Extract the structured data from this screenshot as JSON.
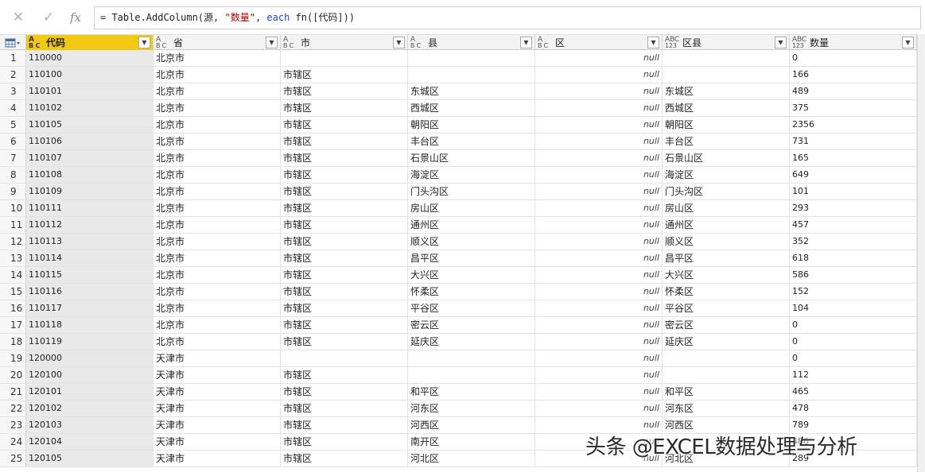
{
  "formula_bar": {
    "cancel_icon": "close-icon",
    "commit_icon": "check-icon",
    "fx_label": "fx",
    "formula_parts": {
      "p1": "= Table.AddColumn(源, ",
      "p2": "\"数量\"",
      "p3": ", ",
      "p4": "each",
      "p5": " fn([代码]))"
    }
  },
  "columns": [
    {
      "type_top": "A",
      "type_bottom": "B C",
      "name": "代码",
      "selected": true
    },
    {
      "type_top": "A",
      "type_bottom": "B C",
      "name": "省"
    },
    {
      "type_top": "A",
      "type_bottom": "B C",
      "name": "市"
    },
    {
      "type_top": "A",
      "type_bottom": "B C",
      "name": "县"
    },
    {
      "type_top": "A",
      "type_bottom": "B C",
      "name": "区"
    },
    {
      "type_top": "ABC",
      "type_bottom": "123",
      "name": "区县"
    },
    {
      "type_top": "ABC",
      "type_bottom": "123",
      "name": "数量"
    }
  ],
  "rows": [
    {
      "i": "1",
      "c": [
        "110000",
        "北京市",
        "",
        "",
        "null",
        "",
        "0"
      ]
    },
    {
      "i": "2",
      "c": [
        "110100",
        "北京市",
        "市辖区",
        "",
        "null",
        "",
        "166"
      ]
    },
    {
      "i": "3",
      "c": [
        "110101",
        "北京市",
        "市辖区",
        "东城区",
        "null",
        "东城区",
        "489"
      ]
    },
    {
      "i": "4",
      "c": [
        "110102",
        "北京市",
        "市辖区",
        "西城区",
        "null",
        "西城区",
        "375"
      ]
    },
    {
      "i": "5",
      "c": [
        "110105",
        "北京市",
        "市辖区",
        "朝阳区",
        "null",
        "朝阳区",
        "2356"
      ]
    },
    {
      "i": "6",
      "c": [
        "110106",
        "北京市",
        "市辖区",
        "丰台区",
        "null",
        "丰台区",
        "731"
      ]
    },
    {
      "i": "7",
      "c": [
        "110107",
        "北京市",
        "市辖区",
        "石景山区",
        "null",
        "石景山区",
        "165"
      ]
    },
    {
      "i": "8",
      "c": [
        "110108",
        "北京市",
        "市辖区",
        "海淀区",
        "null",
        "海淀区",
        "649"
      ]
    },
    {
      "i": "9",
      "c": [
        "110109",
        "北京市",
        "市辖区",
        "门头沟区",
        "null",
        "门头沟区",
        "101"
      ]
    },
    {
      "i": "10",
      "c": [
        "110111",
        "北京市",
        "市辖区",
        "房山区",
        "null",
        "房山区",
        "293"
      ]
    },
    {
      "i": "11",
      "c": [
        "110112",
        "北京市",
        "市辖区",
        "通州区",
        "null",
        "通州区",
        "457"
      ]
    },
    {
      "i": "12",
      "c": [
        "110113",
        "北京市",
        "市辖区",
        "顺义区",
        "null",
        "顺义区",
        "352"
      ]
    },
    {
      "i": "13",
      "c": [
        "110114",
        "北京市",
        "市辖区",
        "昌平区",
        "null",
        "昌平区",
        "618"
      ]
    },
    {
      "i": "14",
      "c": [
        "110115",
        "北京市",
        "市辖区",
        "大兴区",
        "null",
        "大兴区",
        "586"
      ]
    },
    {
      "i": "15",
      "c": [
        "110116",
        "北京市",
        "市辖区",
        "怀柔区",
        "null",
        "怀柔区",
        "152"
      ]
    },
    {
      "i": "16",
      "c": [
        "110117",
        "北京市",
        "市辖区",
        "平谷区",
        "null",
        "平谷区",
        "104"
      ]
    },
    {
      "i": "17",
      "c": [
        "110118",
        "北京市",
        "市辖区",
        "密云区",
        "null",
        "密云区",
        "0"
      ]
    },
    {
      "i": "18",
      "c": [
        "110119",
        "北京市",
        "市辖区",
        "延庆区",
        "null",
        "延庆区",
        "0"
      ]
    },
    {
      "i": "19",
      "c": [
        "120000",
        "天津市",
        "",
        "",
        "null",
        "",
        "0"
      ]
    },
    {
      "i": "20",
      "c": [
        "120100",
        "天津市",
        "市辖区",
        "",
        "null",
        "",
        "112"
      ]
    },
    {
      "i": "21",
      "c": [
        "120101",
        "天津市",
        "市辖区",
        "和平区",
        "null",
        "和平区",
        "465"
      ]
    },
    {
      "i": "22",
      "c": [
        "120102",
        "天津市",
        "市辖区",
        "河东区",
        "null",
        "河东区",
        "478"
      ]
    },
    {
      "i": "23",
      "c": [
        "120103",
        "天津市",
        "市辖区",
        "河西区",
        "null",
        "河西区",
        "789"
      ]
    },
    {
      "i": "24",
      "c": [
        "120104",
        "天津市",
        "市辖区",
        "南开区",
        "null",
        "",
        "486"
      ]
    },
    {
      "i": "25",
      "c": [
        "120105",
        "天津市",
        "市辖区",
        "河北区",
        "null",
        "河北区",
        "289"
      ]
    }
  ],
  "watermark": "头条 @EXCEL数据处理与分析"
}
